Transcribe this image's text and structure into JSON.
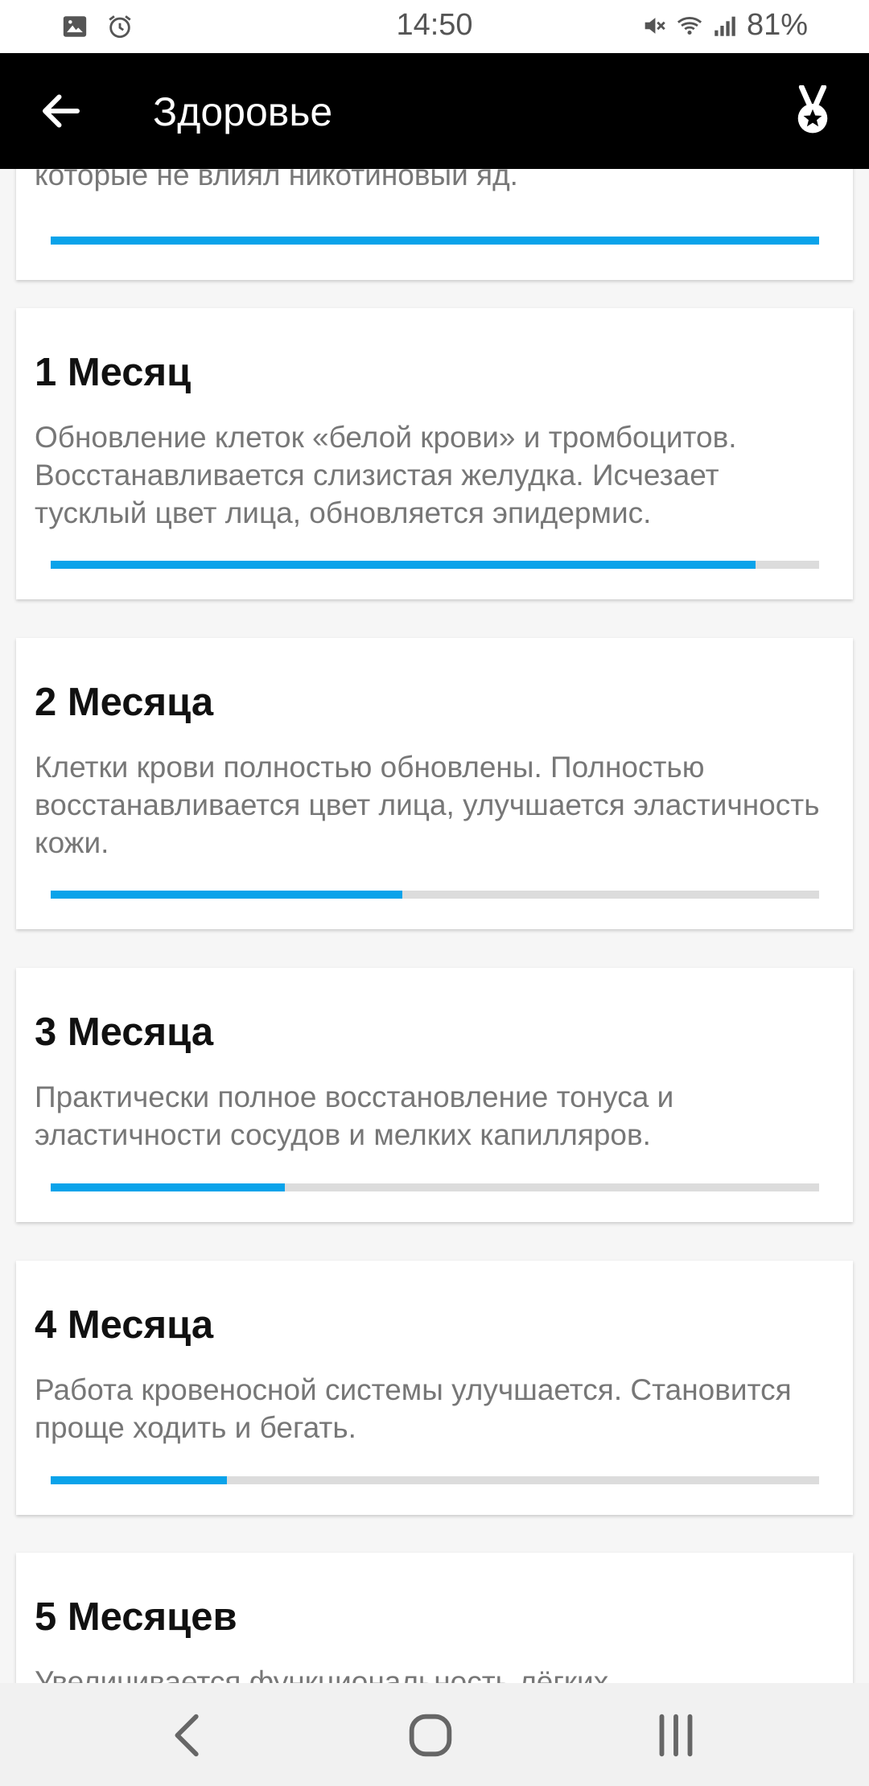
{
  "status_bar": {
    "time": "14:50",
    "battery": "81%",
    "left_icons": [
      "image-icon",
      "alarm-icon"
    ],
    "right_icons": [
      "mute-icon",
      "wifi-icon",
      "signal-icon"
    ]
  },
  "app_bar": {
    "title": "Здоровье",
    "back_icon": "arrow-left-icon",
    "action_icon": "medal-icon"
  },
  "accent_color": "#0aa3ea",
  "cards": [
    {
      "title": "",
      "description": "которые не влиял никотиновый яд.",
      "progress": 1.0
    },
    {
      "title": "1 Месяц",
      "description": "Обновление клеток «белой крови» и тромбоцитов. Восстанавливается слизистая желудка. Исчезает тусклый цвет лица, обновляется эпидермис.",
      "progress": 0.917
    },
    {
      "title": "2 Месяца",
      "description": "Клетки крови полностью обновлены. Полностью восстанавливается цвет лица, улучшается эластичность кожи.",
      "progress": 0.458
    },
    {
      "title": "3 Месяца",
      "description": "Практически полное восстановление тонуса и эластичности сосудов и мелких капилляров.",
      "progress": 0.305
    },
    {
      "title": "4 Месяца",
      "description": "Работа кровеносной системы улучшается. Становится проще ходить и бегать.",
      "progress": 0.229
    },
    {
      "title": "5 Месяцев",
      "description": "Увеличивается функциональность лёгких",
      "progress": null
    }
  ],
  "nav_bar": {
    "back_icon": "nav-back-icon",
    "home_icon": "nav-home-icon",
    "recents_icon": "nav-recents-icon"
  }
}
